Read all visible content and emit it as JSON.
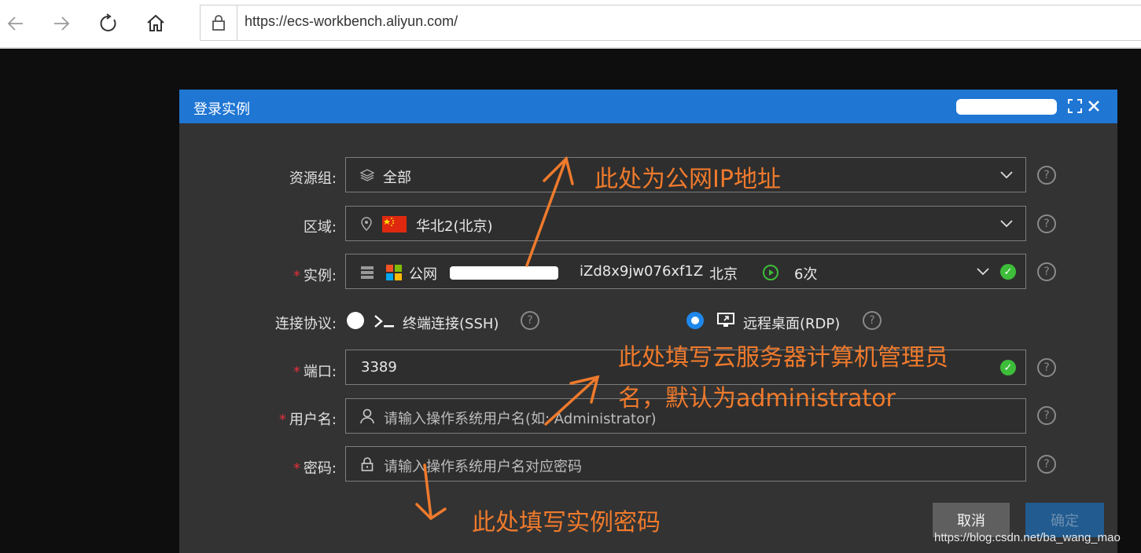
{
  "browser": {
    "url": "https://ecs-workbench.aliyun.com/"
  },
  "dialog": {
    "title": "登录实例",
    "resource_group": {
      "label": "资源组:",
      "value": "全部"
    },
    "region": {
      "label": "区域:",
      "value": "华北2(北京)"
    },
    "instance": {
      "label": "实例:",
      "ip_label": "公网",
      "instance_id": "iZd8x9jw076xf1Z",
      "city": "北京",
      "count": "6次"
    },
    "protocol": {
      "label": "连接协议:",
      "ssh": "终端连接(SSH)",
      "rdp": "远程桌面(RDP)",
      "selected": "rdp"
    },
    "port": {
      "label": "端口:",
      "value": "3389"
    },
    "username": {
      "label": "用户名:",
      "placeholder": "请输入操作系统用户名(如: Administrator)"
    },
    "password": {
      "label": "密码:",
      "placeholder": "请输入操作系统用户名对应密码"
    },
    "cancel_label": "取消",
    "ok_label": "确定"
  },
  "annotations": {
    "ip": "此处为公网IP地址",
    "admin_line1": "此处填写云服务器计算机管理员",
    "admin_line2": "名，默认为administrator",
    "password": "此处填写实例密码"
  },
  "watermark": "https://blog.csdn.net/ba_wang_mao",
  "colors": {
    "header_blue": "#1f76d3",
    "annotation_orange": "#ef7a2c",
    "success_green": "#3dbd3a",
    "required_red": "#e0303a"
  }
}
